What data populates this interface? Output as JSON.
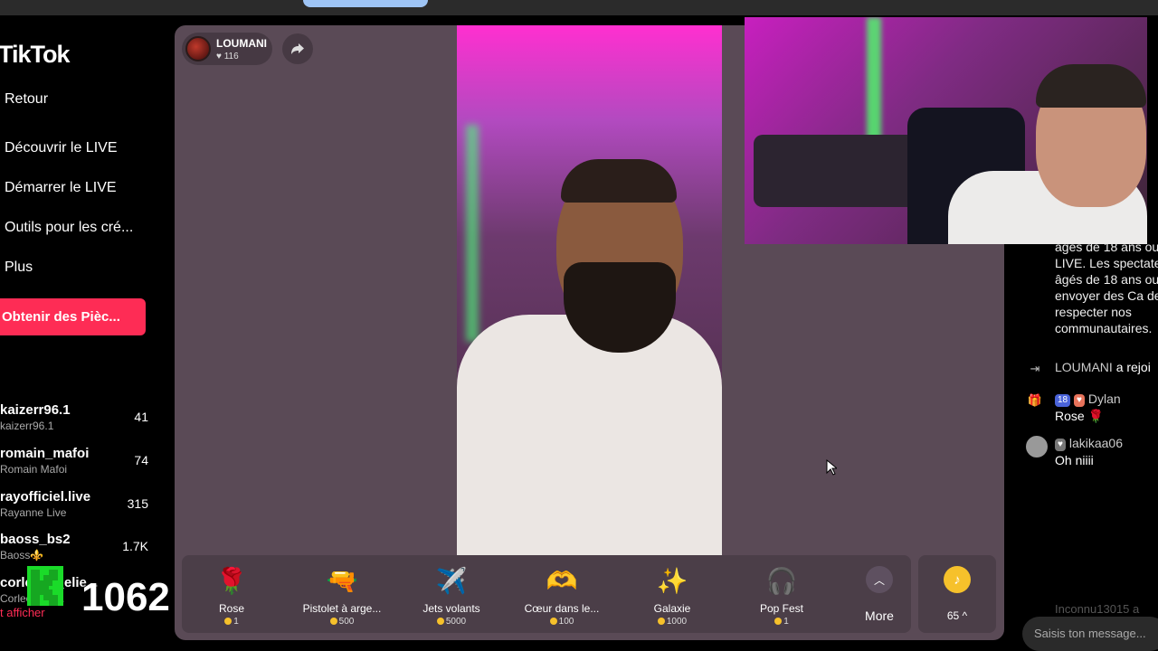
{
  "app": {
    "logo": "TikTok"
  },
  "sidebar": {
    "nav": [
      "Retour",
      "Découvrir le LIVE",
      "Démarrer le LIVE",
      "Outils pour les cré...",
      "Plus"
    ],
    "coins_button": "Obtenir des Pièc...",
    "accounts": [
      {
        "handle": "kaizerr96.1",
        "name": "kaizerr96.1",
        "count": "41"
      },
      {
        "handle": "romain_mafoi",
        "name": "Romain Mafoi",
        "count": "74"
      },
      {
        "handle": "rayofficiel.live",
        "name": "Rayanne Live",
        "count": "315"
      },
      {
        "handle": "baoss_bs2",
        "name": "Baoss⚜️",
        "count": "1.7K"
      },
      {
        "handle": "corleone_elie...",
        "name": "Corleone el...",
        "count": ""
      }
    ],
    "show_more": "t afficher"
  },
  "overlay": {
    "counter": "1062"
  },
  "live": {
    "host_name": "LOUMANI",
    "host_likes": "116"
  },
  "gifts": [
    {
      "name": "Rose",
      "price": "1",
      "icon": "rose-icon",
      "glyph": "🌹"
    },
    {
      "name": "Pistolet à arge...",
      "price": "500",
      "icon": "money-gun-icon",
      "glyph": "🔫"
    },
    {
      "name": "Jets volants",
      "price": "5000",
      "icon": "jet-icon",
      "glyph": "✈️"
    },
    {
      "name": "Cœur dans le...",
      "price": "100",
      "icon": "heart-hands-icon",
      "glyph": "🫶"
    },
    {
      "name": "Galaxie",
      "price": "1000",
      "icon": "galaxy-icon",
      "glyph": "✨"
    },
    {
      "name": "Pop Fest",
      "price": "1",
      "icon": "pop-fest-icon",
      "glyph": "🎧"
    }
  ],
  "gift_more": "More",
  "wallet": {
    "balance": "65",
    "caret": "^"
  },
  "chat": {
    "rules_text": "âgés de 18 ans ou LIVE. Les spectate âgés de 18 ans ou et envoyer des Ca de respecter nos communautaires.",
    "messages": [
      {
        "type": "join",
        "user": "LOUMANI",
        "text": "a rejoi"
      },
      {
        "type": "gift",
        "level": "18",
        "user": "Dylan",
        "text": "Rose 🌹"
      },
      {
        "type": "comment",
        "user": "lakikaa06",
        "text": "Oh niiii"
      }
    ],
    "faded": "Inconnu13015 a",
    "input_placeholder": "Saisis ton message..."
  },
  "colors": {
    "accent": "#fe2c55",
    "coin": "#f6c12b",
    "panel": "#5a4a56"
  }
}
